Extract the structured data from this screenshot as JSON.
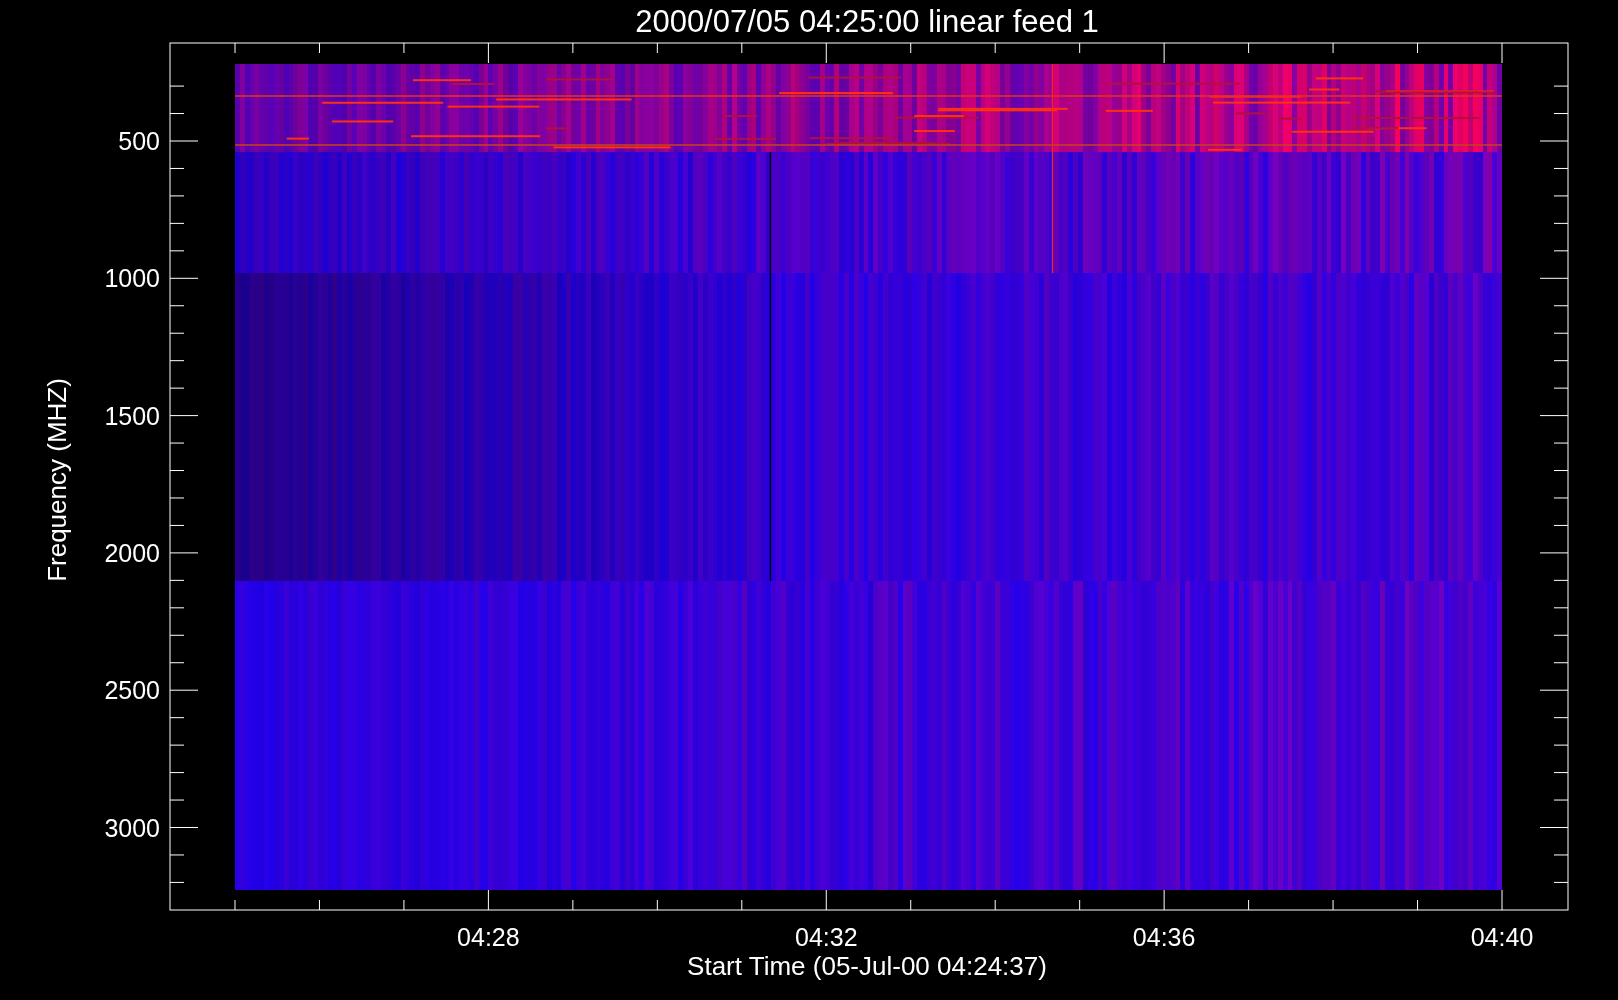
{
  "plot": {
    "title": "2000/07/05 04:25:00 linear feed 1",
    "x_axis": {
      "label": "Start Time (05-Jul-00 04:24:37)",
      "ticks": [
        "04:28",
        "04:32",
        "04:36",
        "04:40"
      ]
    },
    "y_axis": {
      "label": "Frequency (MHZ)",
      "ticks": [
        "500",
        "1000",
        "1500",
        "2000",
        "2500",
        "3000"
      ]
    }
  }
}
